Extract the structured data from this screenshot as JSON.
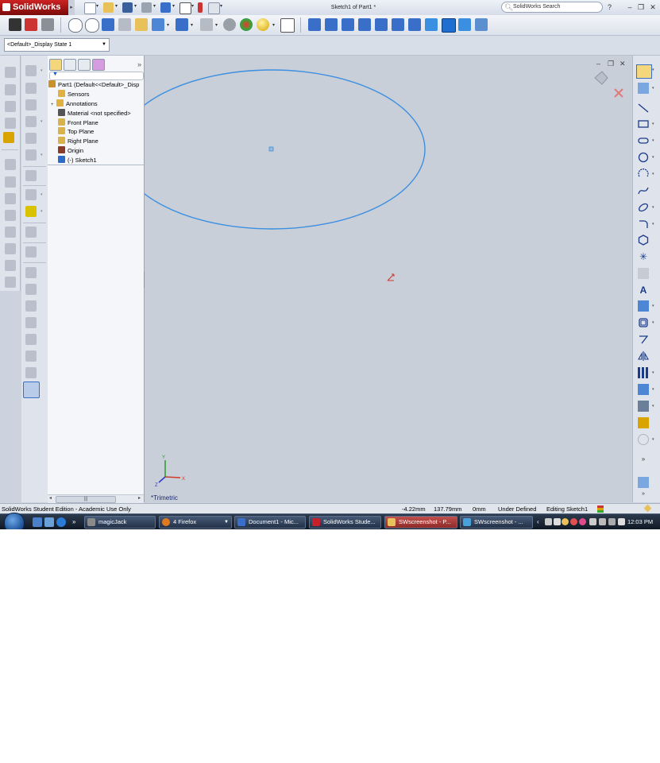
{
  "app": {
    "logo_text": "SolidWorks",
    "document_title": "Sketch1 of Part1 *",
    "search_placeholder": "SolidWorks Search",
    "help_label": "?"
  },
  "display_state": {
    "value": "<Default>_Display State 1"
  },
  "feature_tree": {
    "items": [
      {
        "label": "Part1  (Default<<Default>_Disp",
        "icon": "part-icon",
        "color": "#c8912a"
      },
      {
        "label": "Sensors",
        "icon": "sensor-icon",
        "color": "#e0b040"
      },
      {
        "label": "Annotations",
        "icon": "annotation-icon",
        "color": "#e0b040",
        "expandable": true
      },
      {
        "label": "Material <not specified>",
        "icon": "material-icon",
        "color": "#555555"
      },
      {
        "label": "Front Plane",
        "icon": "plane-icon",
        "color": "#d9b34a"
      },
      {
        "label": "Top Plane",
        "icon": "plane-icon",
        "color": "#d9b34a"
      },
      {
        "label": "Right Plane",
        "icon": "plane-icon",
        "color": "#d9b34a"
      },
      {
        "label": "Origin",
        "icon": "origin-icon",
        "color": "#8a3a2a"
      },
      {
        "label": "(-) Sketch1",
        "icon": "sketch-icon",
        "color": "#2a6cc7"
      }
    ],
    "scroll_thumb": "|||"
  },
  "graphics": {
    "view_label": "*Trimetric",
    "sketch_color": "#3d8fe0",
    "axis_labels": {
      "x": "X",
      "y": "Y",
      "z": "Z"
    }
  },
  "statusbar": {
    "edition": "SolidWorks Student Edition - Academic Use Only",
    "x_coord": "-4.22mm",
    "y_coord": "137.79mm",
    "z_coord": "0mm",
    "sketch_state": "Under Defined",
    "mode": "Editing Sketch1"
  },
  "taskbar": {
    "tasks": [
      {
        "label": "magicJack",
        "icon": "magicjack-icon",
        "color": "#8a8a8a"
      },
      {
        "label": "4 Firefox",
        "icon": "firefox-icon",
        "color": "#e07a1f",
        "has_dropdown": true
      },
      {
        "label": "Document1 - Mic...",
        "icon": "word-icon",
        "color": "#3a6fc9"
      },
      {
        "label": "SolidWorks Stude...",
        "icon": "solidworks-icon",
        "color": "#c8202a"
      },
      {
        "label": "SWscreenshot - P...",
        "icon": "paint-icon",
        "color": "#e8c15a",
        "active": true
      },
      {
        "label": "SWscreenshot - ...",
        "icon": "picture-viewer-icon",
        "color": "#4aa0d8"
      }
    ],
    "clock": "12:03 PM"
  },
  "colors": {
    "graphics_bg": "#c9cfd9",
    "accent": "#2a6cc7"
  }
}
